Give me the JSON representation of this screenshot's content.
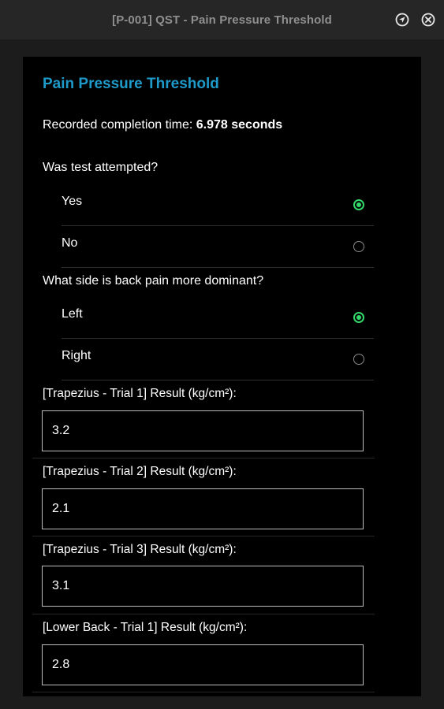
{
  "window": {
    "title": "[P-001] QST - Pain Pressure Threshold",
    "icons": [
      "navigate-icon",
      "close-icon"
    ]
  },
  "panel": {
    "title": "Pain Pressure Threshold",
    "completion_label": "Recorded completion time:",
    "completion_value": "6.978 seconds"
  },
  "questions": [
    {
      "text": "Was test attempted?",
      "options": [
        {
          "label": "Yes",
          "selected": true
        },
        {
          "label": "No",
          "selected": false
        }
      ]
    },
    {
      "text": "What side is back pain more dominant?",
      "options": [
        {
          "label": "Left",
          "selected": true
        },
        {
          "label": "Right",
          "selected": false
        }
      ]
    }
  ],
  "fields": [
    {
      "label": "[Trapezius - Trial 1] Result (kg/cm²):",
      "value": "3.2"
    },
    {
      "label": "[Trapezius - Trial 2] Result (kg/cm²):",
      "value": "2.1"
    },
    {
      "label": "[Trapezius - Trial 3] Result (kg/cm²):",
      "value": "3.1"
    },
    {
      "label": "[Lower Back - Trial 1] Result (kg/cm²):",
      "value": "2.8"
    }
  ],
  "colors": {
    "accent": "#1e9ac8",
    "radio_selected": "#33d86a"
  }
}
